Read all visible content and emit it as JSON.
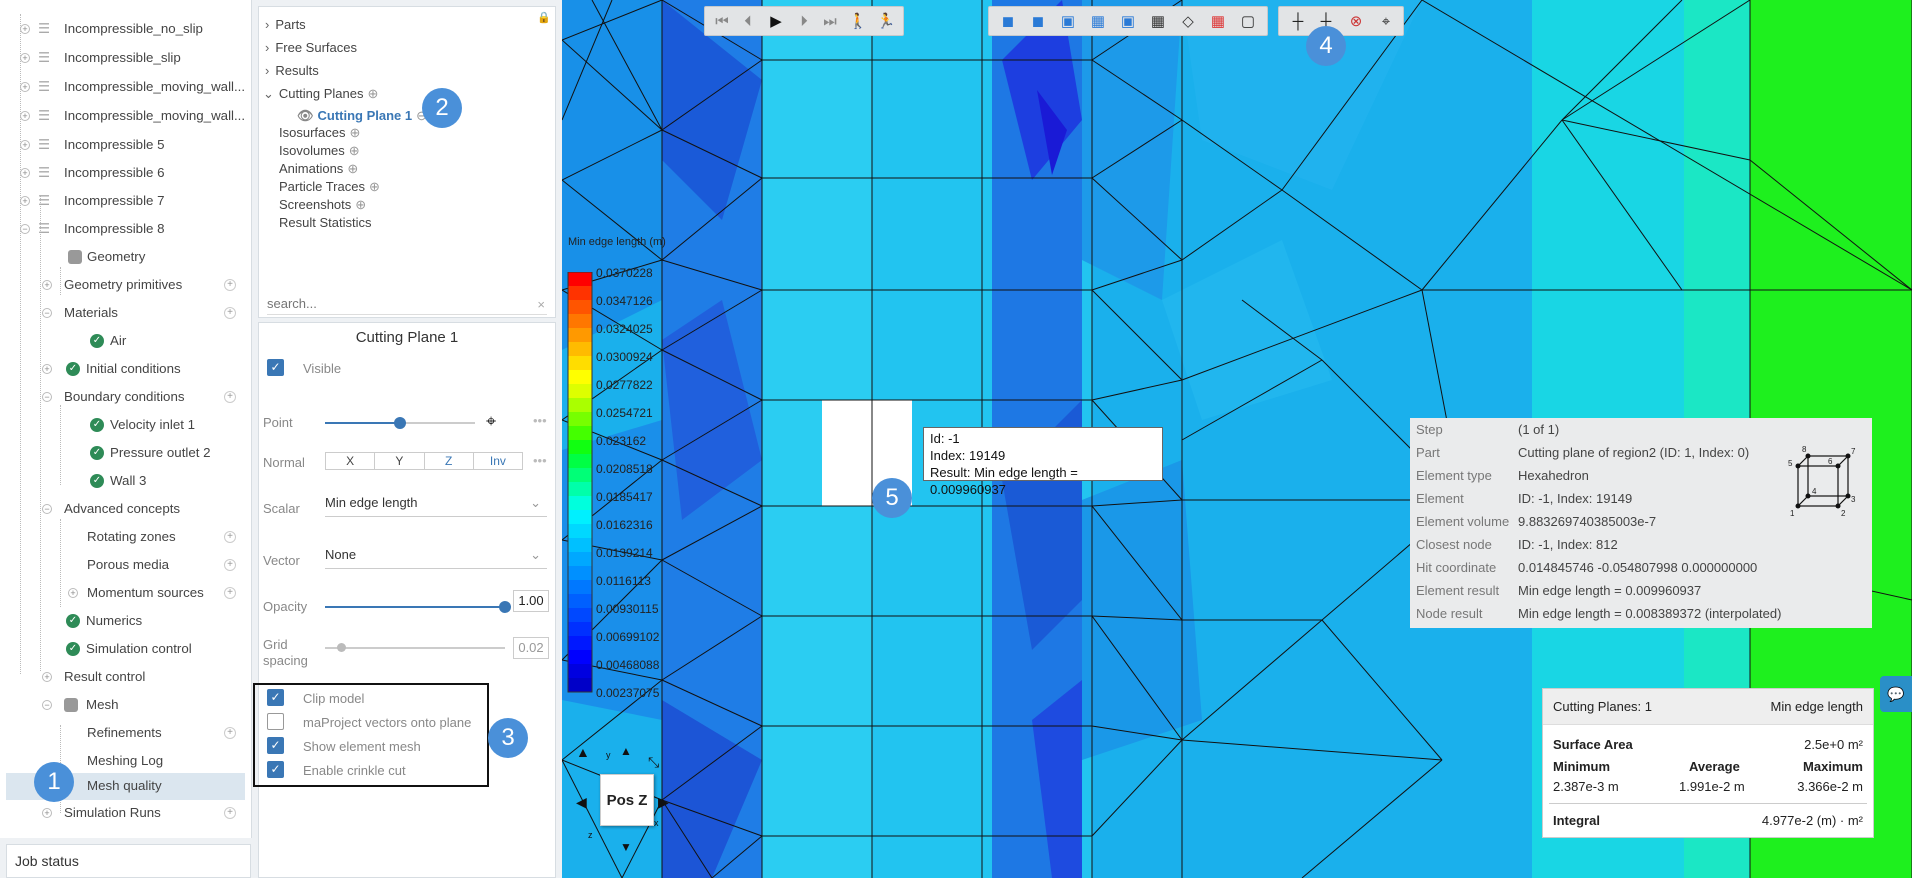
{
  "tree": {
    "items": [
      {
        "label": "Incompressible_no_slip"
      },
      {
        "label": "Incompressible_slip"
      },
      {
        "label": "Incompressible_moving_wall..."
      },
      {
        "label": "Incompressible_moving_wall..."
      },
      {
        "label": "Incompressible 5"
      },
      {
        "label": "Incompressible 6"
      },
      {
        "label": "Incompressible 7"
      },
      {
        "label": "Incompressible 8"
      },
      {
        "label": "Geometry"
      },
      {
        "label": "Geometry primitives"
      },
      {
        "label": "Materials"
      },
      {
        "label": "Air"
      },
      {
        "label": "Initial conditions"
      },
      {
        "label": "Boundary conditions"
      },
      {
        "label": "Velocity inlet 1"
      },
      {
        "label": "Pressure outlet 2"
      },
      {
        "label": "Wall 3"
      },
      {
        "label": "Advanced concepts"
      },
      {
        "label": "Rotating zones"
      },
      {
        "label": "Porous media"
      },
      {
        "label": "Momentum sources"
      },
      {
        "label": "Numerics"
      },
      {
        "label": "Simulation control"
      },
      {
        "label": "Result control"
      },
      {
        "label": "Mesh"
      },
      {
        "label": "Refinements"
      },
      {
        "label": "Meshing Log"
      },
      {
        "label": "Mesh quality"
      },
      {
        "label": "Simulation Runs"
      }
    ],
    "job_status": "Job status"
  },
  "objects": {
    "items": [
      "Parts",
      "Free Surfaces",
      "Results",
      "Cutting Planes",
      "Cutting Plane 1",
      "Isosurfaces",
      "Isovolumes",
      "Animations",
      "Particle Traces",
      "Screenshots",
      "Result Statistics"
    ],
    "search_placeholder": "search..."
  },
  "props": {
    "title": "Cutting Plane 1",
    "visible": "Visible",
    "point": "Point",
    "normal": "Normal",
    "normal_opts": [
      "X",
      "Y",
      "Z",
      "Inv"
    ],
    "scalar": "Scalar",
    "scalar_value": "Min edge length",
    "vector": "Vector",
    "vector_value": "None",
    "opacity": "Opacity",
    "opacity_value": "1.00",
    "opacity_level": 1.0,
    "grid": "Grid",
    "spacing": "spacing",
    "grid_value": "0.02",
    "options": [
      {
        "label": "Clip model",
        "checked": true
      },
      {
        "label": "maProject vectors onto plane",
        "checked": false
      },
      {
        "label": "Show element mesh",
        "checked": true
      },
      {
        "label": "Enable crinkle cut",
        "checked": true
      }
    ]
  },
  "badges": [
    "1",
    "2",
    "3",
    "4",
    "5"
  ],
  "legend": {
    "title": "Min edge length (m)",
    "values": [
      "0.0370228",
      "0.0347126",
      "0.0324025",
      "0.0300924",
      "0.0277822",
      "0.0254721",
      "0.023162",
      "0.0208518",
      "0.0185417",
      "0.0162316",
      "0.0139214",
      "0.0116113",
      "0.00930115",
      "0.00699102",
      "0.00468088",
      "0.00237075"
    ]
  },
  "popup": {
    "id": "Id: -1",
    "index": "Index: 19149",
    "result": "Result: Min edge length = 0.009960937"
  },
  "info": {
    "rows": [
      {
        "k": "Step",
        "v": "(1 of 1)"
      },
      {
        "k": "Part",
        "v": "Cutting plane of region2 (ID: 1, Index: 0)"
      },
      {
        "k": "Element type",
        "v": "Hexahedron"
      },
      {
        "k": "Element",
        "v": "ID: -1, Index: 19149"
      },
      {
        "k": "Element volume",
        "v": "9.883269740385003e-7"
      },
      {
        "k": "Closest node",
        "v": "ID: -1, Index: 812"
      },
      {
        "k": "Hit coordinate",
        "v": "0.014845746 -0.054807998 0.000000000"
      },
      {
        "k": "Element result",
        "v": "Min edge length = 0.009960937"
      },
      {
        "k": "Node result",
        "v": "Min edge length = 0.008389372 (interpolated)"
      }
    ],
    "cube_nodes": [
      "1",
      "2",
      "3",
      "4",
      "5",
      "6",
      "7",
      "8"
    ]
  },
  "stats": {
    "header_left": "Cutting Planes: 1",
    "header_right": "Min edge length",
    "surface_area_label": "Surface Area",
    "surface_area": "2.5e+0 m²",
    "min_label": "Minimum",
    "avg_label": "Average",
    "max_label": "Maximum",
    "min": "2.387e-3 m",
    "avg": "1.991e-2 m",
    "max": "3.366e-2 m",
    "integral_label": "Integral",
    "integral": "4.977e-2 (m) · m²"
  },
  "viewcube": {
    "label": "Pos Z",
    "axis_y": "y",
    "axis_z": "z",
    "axis_x": "x"
  },
  "colors": {
    "accent": "#3a77b5",
    "badge": "#4a90d9",
    "mesh_bg": "#1fb3ee",
    "green": "#1ef01e"
  }
}
